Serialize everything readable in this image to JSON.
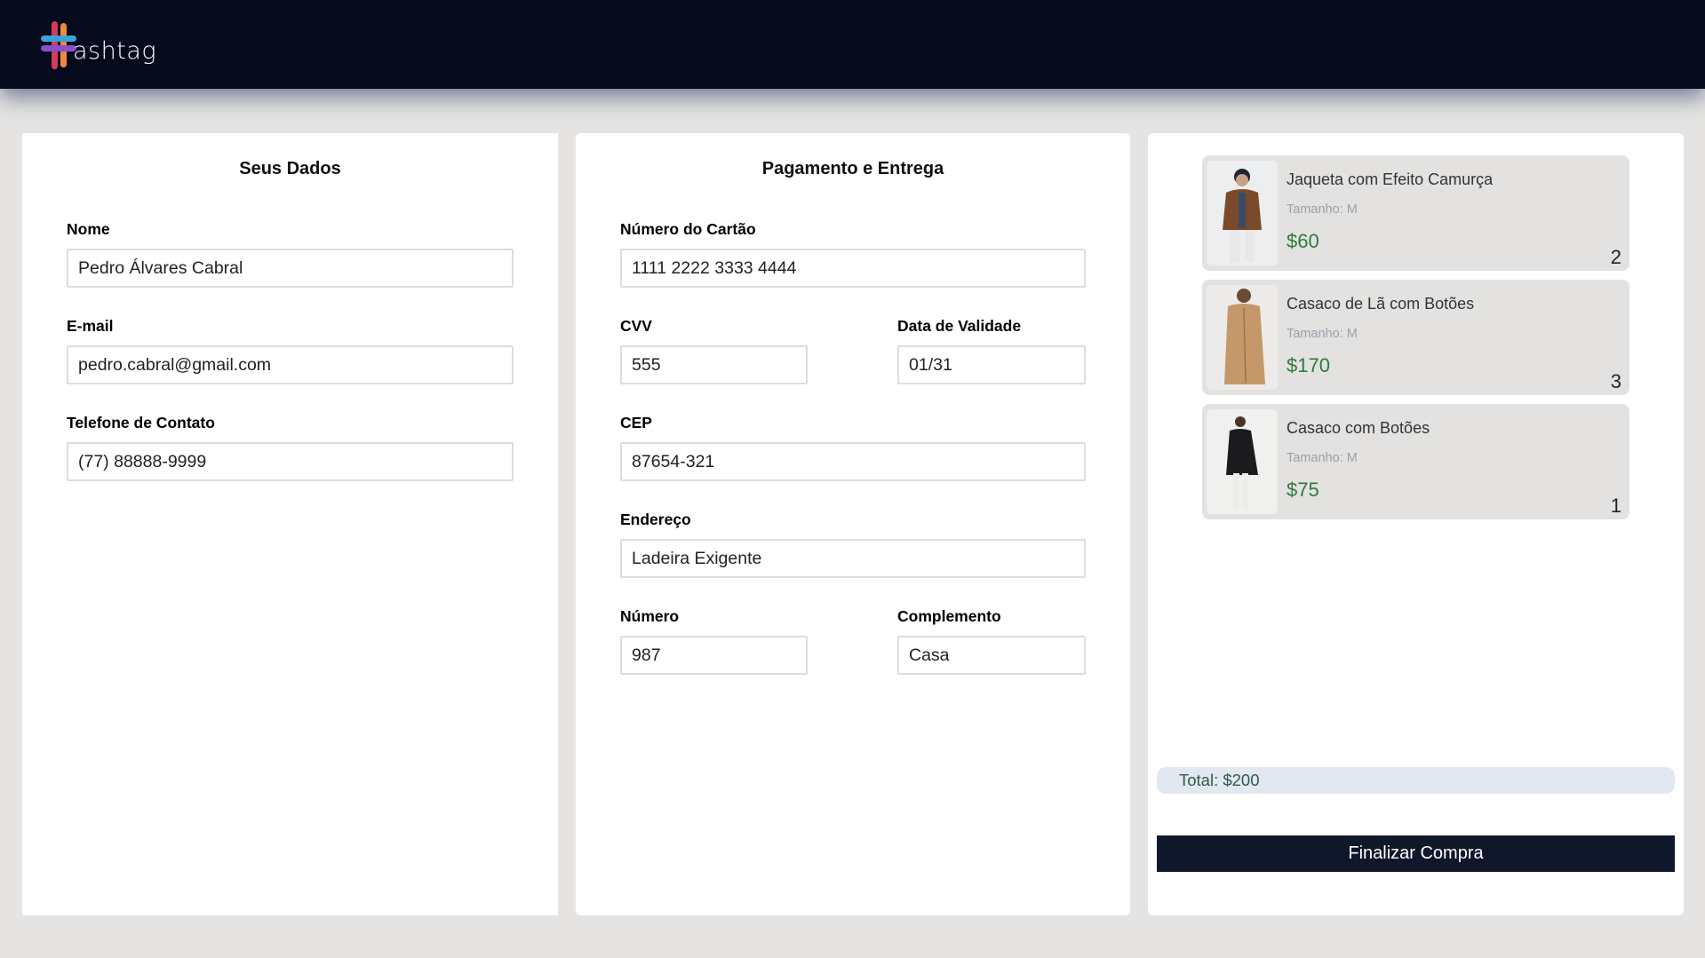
{
  "header": {
    "logo_text": "ashtag"
  },
  "dados": {
    "title": "Seus Dados",
    "nome_label": "Nome",
    "nome_value": "Pedro Álvares Cabral",
    "email_label": "E-mail",
    "email_value": "pedro.cabral@gmail.com",
    "telefone_label": "Telefone de Contato",
    "telefone_value": "(77) 88888-9999"
  },
  "pagamento": {
    "title": "Pagamento e Entrega",
    "cartao_label": "Número do Cartão",
    "cartao_value": "1111 2222 3333 4444",
    "cvv_label": "CVV",
    "cvv_value": "555",
    "validade_label": "Data de Validade",
    "validade_value": "01/31",
    "cep_label": "CEP",
    "cep_value": "87654-321",
    "endereco_label": "Endereço",
    "endereco_value": "Ladeira Exigente",
    "numero_label": "Número",
    "numero_value": "987",
    "complemento_label": "Complemento",
    "complemento_value": "Casa"
  },
  "cart": {
    "items": [
      {
        "name": "Jaqueta com Efeito Camurça",
        "size": "Tamanho: M",
        "price": "$60",
        "qty": "2",
        "image": "jacket-photo"
      },
      {
        "name": "Casaco de Lã com Botões",
        "size": "Tamanho: M",
        "price": "$170",
        "qty": "3",
        "image": "wool-coat-photo"
      },
      {
        "name": "Casaco com Botões",
        "size": "Tamanho: M",
        "price": "$75",
        "qty": "1",
        "image": "black-coat-photo"
      }
    ],
    "total": "Total: $200",
    "finalize_label": "Finalizar Compra"
  },
  "colors": {
    "header_bg": "#050a1c",
    "price_green": "#2d7a3c",
    "button_bg": "#0f172a",
    "total_bg": "#e2e8f0"
  }
}
